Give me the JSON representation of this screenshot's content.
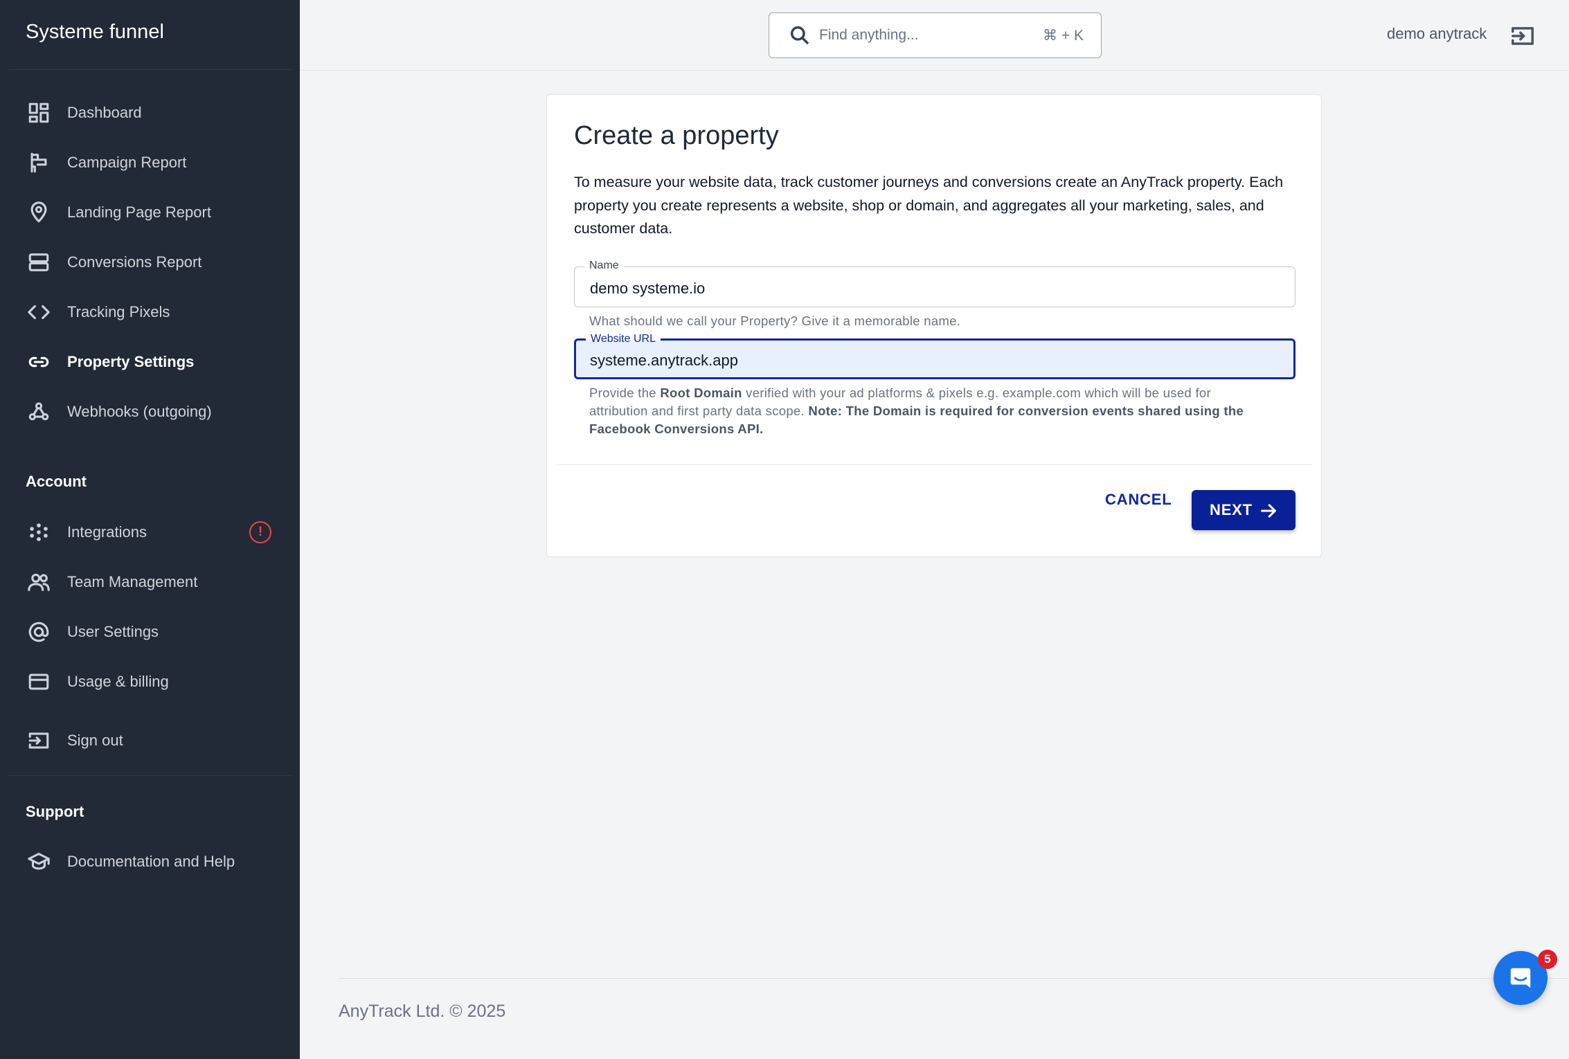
{
  "app": {
    "brand": "Systeme funnel"
  },
  "sidebar": {
    "items": [
      {
        "label": "Dashboard",
        "icon": "dashboard-icon"
      },
      {
        "label": "Campaign Report",
        "icon": "campaign-icon"
      },
      {
        "label": "Landing Page Report",
        "icon": "location-pin-icon"
      },
      {
        "label": "Conversions Report",
        "icon": "server-icon"
      },
      {
        "label": "Tracking Pixels",
        "icon": "code-icon"
      },
      {
        "label": "Property Settings",
        "icon": "link-icon",
        "active": true
      },
      {
        "label": "Webhooks (outgoing)",
        "icon": "webhook-icon"
      }
    ],
    "account_title": "Account",
    "account_items": [
      {
        "label": "Integrations",
        "icon": "integrations-icon",
        "alert": "!"
      },
      {
        "label": "Team Management",
        "icon": "team-icon"
      },
      {
        "label": "User Settings",
        "icon": "at-icon"
      },
      {
        "label": "Usage & billing",
        "icon": "credit-card-icon"
      }
    ],
    "signout_label": "Sign out",
    "support_title": "Support",
    "support_items": [
      {
        "label": "Documentation and Help",
        "icon": "graduation-cap-icon"
      }
    ]
  },
  "topbar": {
    "search_placeholder": "Find anything...",
    "search_shortcut": "⌘ + K",
    "user_name": "demo anytrack"
  },
  "form": {
    "title": "Create a property",
    "description": "To measure your website data, track customer journeys and conversions create an AnyTrack property. Each property you create represents a website, shop or domain, and aggregates all your marketing, sales, and customer data.",
    "name_label": "Name",
    "name_value": "demo systeme.io",
    "name_helper": "What should we call your Property? Give it a memorable name.",
    "url_label": "Website URL",
    "url_value": "systeme.anytrack.app",
    "url_helper_1": "Provide the ",
    "url_helper_bold_1": "Root Domain",
    "url_helper_2": " verified with your ad platforms & pixels e.g. example.com which will be used for",
    "url_helper_3": "attribution and first party data scope. ",
    "url_helper_bold_2": "Note: The Domain is required for conversion events shared using the",
    "url_helper_bold_3": "Facebook Conversions API.",
    "cancel_label": "CANCEL",
    "next_label": "NEXT"
  },
  "footer": {
    "text": "AnyTrack Ltd. © 2025"
  },
  "chat": {
    "badge_count": "5"
  },
  "colors": {
    "sidebar_bg": "#222937",
    "primary": "#0a2096",
    "alert": "#ef4444",
    "chat": "#1a73e8"
  }
}
